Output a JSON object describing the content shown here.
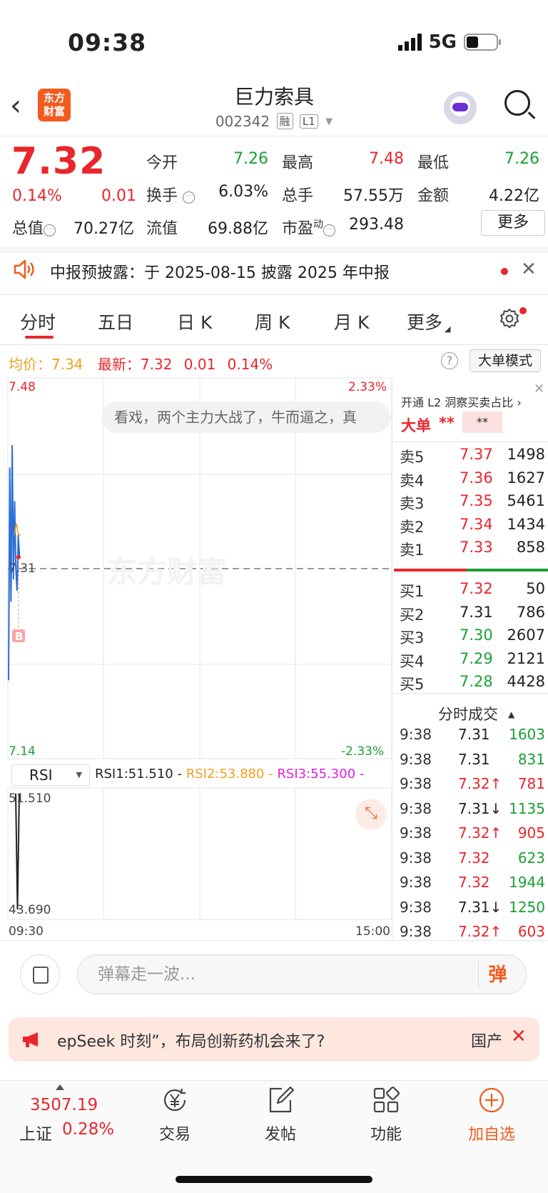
{
  "status": {
    "time": "09:38",
    "network": "5G"
  },
  "header": {
    "logo_line1": "东方",
    "logo_line2": "财富",
    "stock_name": "巨力索具",
    "stock_code": "002342",
    "tag1": "融",
    "tag2": "L1"
  },
  "quote": {
    "price": "7.32",
    "pct": "0.14%",
    "change": "0.01",
    "open_label": "今开",
    "open": "7.26",
    "high_label": "最高",
    "high": "7.48",
    "low_label": "最低",
    "low": "7.26",
    "turnover_label": "换手",
    "turnover": "6.03%",
    "volume_label": "总手",
    "volume": "57.55万",
    "amount_label": "金额",
    "amount": "4.22亿",
    "mktcap_label": "总值",
    "mktcap": "70.27亿",
    "float_label": "流值",
    "float": "69.88亿",
    "pe_label": "市盈",
    "pe_sup": "动",
    "pe": "293.48",
    "more": "更多"
  },
  "notice": {
    "text": "中报预披露：于 2025-08-15 披露 2025 年中报",
    "close": "✕"
  },
  "tabs": [
    "分时",
    "五日",
    "日 K",
    "周 K",
    "月 K",
    "更多"
  ],
  "chart_header": {
    "avg_label": "均价：",
    "avg": "7.34",
    "latest_label": "最新：",
    "latest": "7.32",
    "change": "0.01",
    "pct": "0.14%",
    "help": "?",
    "big_order_mode": "大单模式"
  },
  "chart": {
    "y_top": "7.48",
    "y_top_pct": "2.33%",
    "y_mid": "7.31",
    "y_bottom": "7.14",
    "y_bottom_pct": "-2.33%",
    "danmu": "看戏，两个主力大战了，牛而逼之，真",
    "watermark": "东方财富",
    "buy_marker": "B",
    "rsi_name": "RSI",
    "rsi1": "RSI1:51.510 -",
    "rsi2": "RSI2:53.880 -",
    "rsi3": "RSI3:55.300 -",
    "rsi_top": "51.510",
    "rsi_bottom": "43.690",
    "time_start": "09:30",
    "time_end": "15:00"
  },
  "chart_data": {
    "type": "line",
    "title": "",
    "price_range": [
      7.14,
      7.48
    ],
    "prev_close": 7.31,
    "x_range": [
      "09:30",
      "15:00"
    ],
    "series": [
      {
        "values": [
          7.21,
          7.4,
          7.28,
          7.42,
          7.3,
          7.37,
          7.31,
          7.29,
          7.34,
          7.32
        ]
      },
      {
        "values": [
          7.34,
          7.35,
          7.34,
          7.34
        ]
      }
    ],
    "rsi_range": [
      43.69,
      51.51
    ],
    "rsi_values": [
      51.51,
      43.69,
      51.51
    ]
  },
  "orderbook": {
    "l2_promo": "开通 L2 洞察买卖占比 ›",
    "big_label": "大单",
    "big_val1": "**",
    "big_val2": "**",
    "asks": [
      {
        "label": "卖5",
        "price": "7.37",
        "vol": "1498"
      },
      {
        "label": "卖4",
        "price": "7.36",
        "vol": "1627"
      },
      {
        "label": "卖3",
        "price": "7.35",
        "vol": "5461"
      },
      {
        "label": "卖2",
        "price": "7.34",
        "vol": "1434"
      },
      {
        "label": "卖1",
        "price": "7.33",
        "vol": "858"
      }
    ],
    "bids": [
      {
        "label": "买1",
        "price": "7.32",
        "vol": "50"
      },
      {
        "label": "买2",
        "price": "7.31",
        "vol": "786"
      },
      {
        "label": "买3",
        "price": "7.30",
        "vol": "2607"
      },
      {
        "label": "买4",
        "price": "7.29",
        "vol": "2121"
      },
      {
        "label": "买5",
        "price": "7.28",
        "vol": "4428"
      }
    ],
    "ask_bid_ratio": 0.47
  },
  "ticks": {
    "title": "分时成交",
    "rows": [
      {
        "t": "9:38",
        "p": "7.31",
        "v": "1603",
        "pc": "#222222",
        "vc": "#1aa033"
      },
      {
        "t": "9:38",
        "p": "7.31",
        "v": "831",
        "pc": "#222222",
        "vc": "#1aa033"
      },
      {
        "t": "9:38",
        "p": "7.32↑",
        "v": "781",
        "pc": "#e8262b",
        "vc": "#e8262b"
      },
      {
        "t": "9:38",
        "p": "7.31↓",
        "v": "1135",
        "pc": "#222222",
        "vc": "#1aa033"
      },
      {
        "t": "9:38",
        "p": "7.32↑",
        "v": "905",
        "pc": "#e8262b",
        "vc": "#e8262b"
      },
      {
        "t": "9:38",
        "p": "7.32",
        "v": "623",
        "pc": "#e8262b",
        "vc": "#1aa033"
      },
      {
        "t": "9:38",
        "p": "7.32",
        "v": "1944",
        "pc": "#e8262b",
        "vc": "#1aa033"
      },
      {
        "t": "9:38",
        "p": "7.31↓",
        "v": "1250",
        "pc": "#222222",
        "vc": "#1aa033"
      },
      {
        "t": "9:38",
        "p": "7.32↑",
        "v": "603",
        "pc": "#e8262b",
        "vc": "#e8262b"
      }
    ]
  },
  "input": {
    "placeholder": "弹幕走一波...",
    "send": "弹"
  },
  "promo": {
    "text": "epSeek 时刻”，布局创新药机会来了?",
    "right": "国产",
    "close": "✕"
  },
  "nav": {
    "index_value": "3507.19",
    "index_name": "上证",
    "index_pct": "0.28%",
    "items": [
      {
        "label": "交易",
        "icon": "yen-cycle-icon"
      },
      {
        "label": "发帖",
        "icon": "edit-icon"
      },
      {
        "label": "功能",
        "icon": "grid-icon"
      },
      {
        "label": "加自选",
        "icon": "plus-circle-icon"
      }
    ]
  },
  "colors": {
    "up": "#e8262b",
    "down": "#1aa033",
    "avg": "#f0a020",
    "price_line": "#2a6fd6",
    "brand": "#f25b1e"
  }
}
